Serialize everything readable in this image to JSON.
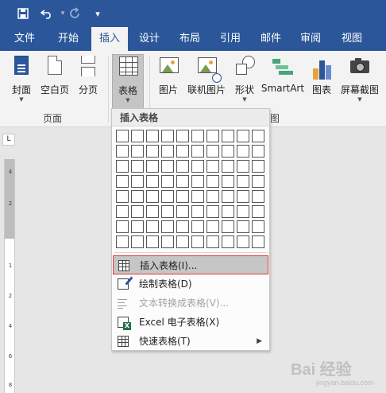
{
  "quick_access": {
    "save": "save-icon",
    "undo": "undo-icon",
    "redo": "redo-icon",
    "customize": "▾"
  },
  "tabs": [
    {
      "label": "文件"
    },
    {
      "label": "开始"
    },
    {
      "label": "插入",
      "active": true
    },
    {
      "label": "设计"
    },
    {
      "label": "布局"
    },
    {
      "label": "引用"
    },
    {
      "label": "邮件"
    },
    {
      "label": "审阅"
    },
    {
      "label": "视图"
    }
  ],
  "ribbon": {
    "pages_group": {
      "label": "页面",
      "buttons": [
        {
          "label": "封面",
          "dropdown": true
        },
        {
          "label": "空白页"
        },
        {
          "label": "分页"
        }
      ]
    },
    "table_group": {
      "button": "表格",
      "dropdown": true
    },
    "illustrations_group": {
      "label": "图",
      "buttons": [
        {
          "label": "图片"
        },
        {
          "label": "联机图片"
        },
        {
          "label": "形状",
          "dropdown": true
        },
        {
          "label": "SmartArt"
        },
        {
          "label": "图表"
        },
        {
          "label": "屏幕截图",
          "dropdown": true
        }
      ]
    }
  },
  "ruler": {
    "corner": "L",
    "numbers": [
      "4",
      "2",
      "1",
      "2",
      "4",
      "6",
      "8"
    ]
  },
  "table_menu": {
    "header": "插入表格",
    "grid": {
      "columns": 10,
      "rows": 8
    },
    "items": [
      {
        "label": "插入表格(I)...",
        "highlighted": true,
        "icon": "table-icon"
      },
      {
        "label": "绘制表格(D)",
        "icon": "draw-table-icon"
      },
      {
        "label": "文本转换成表格(V)...",
        "disabled": true,
        "icon": "convert-text-icon"
      },
      {
        "label": "Excel 电子表格(X)",
        "icon": "excel-icon"
      },
      {
        "label": "快速表格(T)",
        "submenu": true,
        "icon": "quick-table-icon"
      }
    ]
  },
  "watermark": {
    "text": "Bai 经验",
    "sub": "jingyan.baidu.com"
  },
  "colors": {
    "accent": "#2b579a",
    "ribbon_bg": "#f3f3f3",
    "highlight_border": "#e53935"
  }
}
